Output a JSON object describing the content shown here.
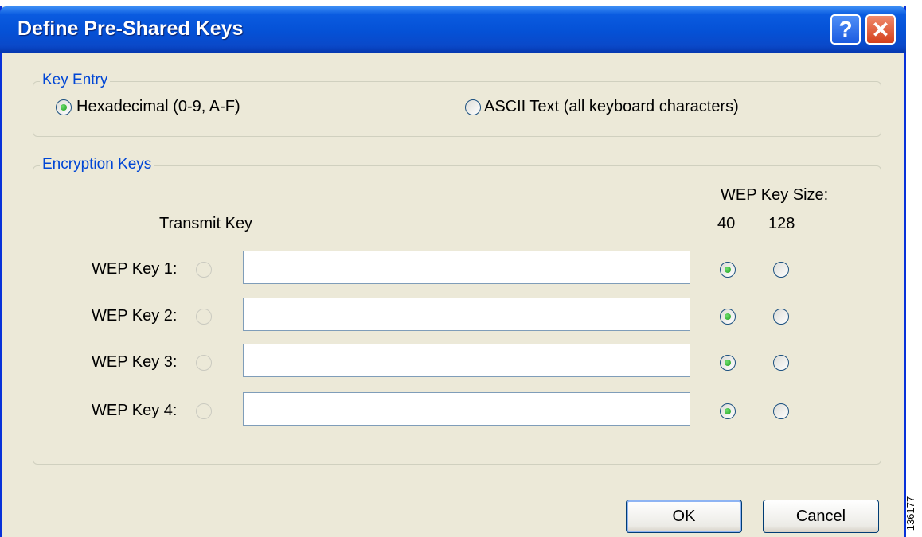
{
  "window": {
    "title": "Define Pre-Shared Keys"
  },
  "titlebar": {
    "help_glyph": "?",
    "close_glyph": "✕"
  },
  "key_entry": {
    "legend": "Key Entry",
    "options": [
      {
        "label": "Hexadecimal (0-9, A-F)",
        "checked": true
      },
      {
        "label": "ASCII Text (all keyboard characters)",
        "checked": false
      }
    ]
  },
  "encryption_keys": {
    "legend": "Encryption Keys",
    "wep_key_size_label": "WEP Key Size:",
    "transmit_key_label": "Transmit Key",
    "size_40_label": "40",
    "size_128_label": "128",
    "keys": [
      {
        "label": "WEP Key 1:",
        "value": "",
        "size": "40"
      },
      {
        "label": "WEP Key 2:",
        "value": "",
        "size": "40"
      },
      {
        "label": "WEP Key 3:",
        "value": "",
        "size": "40"
      },
      {
        "label": "WEP Key 4:",
        "value": "",
        "size": "40"
      }
    ]
  },
  "buttons": {
    "ok": "OK",
    "cancel": "Cancel"
  },
  "figure_id": "136177",
  "colors": {
    "titlebar": "#0a5be0",
    "dialog_bg": "#ece9d8",
    "group_legend": "#0046d5",
    "radio_dot": "#21a121"
  }
}
